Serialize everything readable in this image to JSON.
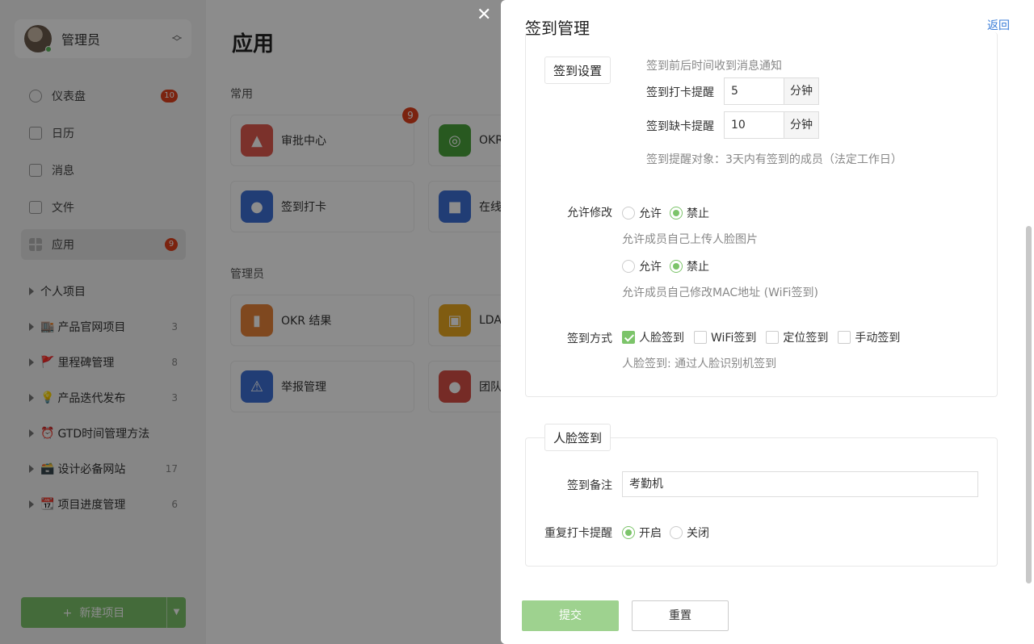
{
  "sidebar": {
    "user": {
      "name": "管理员"
    },
    "nav": [
      {
        "label": "仪表盘",
        "badge": "10"
      },
      {
        "label": "日历",
        "badge": ""
      },
      {
        "label": "消息",
        "badge": ""
      },
      {
        "label": "文件",
        "badge": ""
      },
      {
        "label": "应用",
        "badge": "9"
      }
    ],
    "projects": [
      {
        "emoji": "",
        "label": "个人项目",
        "count": ""
      },
      {
        "emoji": "🏬",
        "label": "产品官网项目",
        "count": "3"
      },
      {
        "emoji": "🚩",
        "label": "里程碑管理",
        "count": "8"
      },
      {
        "emoji": "💡",
        "label": "产品迭代发布",
        "count": "3"
      },
      {
        "emoji": "⏰",
        "label": "GTD时间管理方法",
        "count": ""
      },
      {
        "emoji": "🗃️",
        "label": "设计必备网站",
        "count": "17"
      },
      {
        "emoji": "📆",
        "label": "项目进度管理",
        "count": "6"
      }
    ],
    "new_project": {
      "plus": "+",
      "label": "新建项目"
    }
  },
  "main": {
    "title": "应用",
    "sections": [
      {
        "label": "常用",
        "apps": [
          {
            "name": "审批中心",
            "icon": "stamp-icon",
            "color": "#e05a4f",
            "badge": "9"
          },
          {
            "name": "OKR",
            "icon": "target-icon",
            "color": "#4aa33b",
            "badge": ""
          },
          {
            "name": "签到打卡",
            "icon": "location-pin-icon",
            "color": "#3d6fd6",
            "badge": ""
          },
          {
            "name": "在线",
            "icon": "video-icon",
            "color": "#3d6fd6",
            "badge": ""
          }
        ]
      },
      {
        "label": "管理员",
        "apps": [
          {
            "name": "OKR 结果",
            "icon": "bar-chart-icon",
            "color": "#e8833a",
            "badge": ""
          },
          {
            "name": "LDA",
            "icon": "contact-icon",
            "color": "#e9a820",
            "badge": ""
          },
          {
            "name": "举报管理",
            "icon": "warning-icon",
            "color": "#3d6fd6",
            "badge": ""
          },
          {
            "name": "团队",
            "icon": "team-icon",
            "color": "#d84f45",
            "badge": ""
          }
        ]
      }
    ]
  },
  "drawer": {
    "title": "签到管理",
    "back": "返回",
    "settings": {
      "legend": "签到设置",
      "notify_desc": "签到前后时间收到消息通知",
      "checkin_remind": {
        "label": "签到打卡提醒",
        "value": "5",
        "unit": "分钟"
      },
      "missing_remind": {
        "label": "签到缺卡提醒",
        "value": "10",
        "unit": "分钟"
      },
      "remind_target": "签到提醒对象：3天内有签到的成员（法定工作日）",
      "allow_modify": {
        "label": "允许修改",
        "face_photo": {
          "options": [
            "允许",
            "禁止"
          ],
          "selected": "禁止",
          "desc": "允许成员自己上传人脸图片"
        },
        "mac_address": {
          "options": [
            "允许",
            "禁止"
          ],
          "selected": "禁止",
          "desc": "允许成员自己修改MAC地址 (WiFi签到)"
        }
      },
      "methods": {
        "label": "签到方式",
        "options": [
          {
            "label": "人脸签到",
            "checked": true
          },
          {
            "label": "WiFi签到",
            "checked": false
          },
          {
            "label": "定位签到",
            "checked": false
          },
          {
            "label": "手动签到",
            "checked": false
          }
        ],
        "desc": "人脸签到: 通过人脸识别机签到"
      }
    },
    "face": {
      "legend": "人脸签到",
      "remark": {
        "label": "签到备注",
        "value": "考勤机"
      },
      "repeat_remind": {
        "label": "重复打卡提醒",
        "options": [
          "开启",
          "关闭"
        ],
        "selected": "开启"
      }
    },
    "footer": {
      "submit": "提交",
      "reset": "重置"
    }
  },
  "colors": {
    "accent": "#7cc46a",
    "link": "#3a7dd8",
    "badge": "#e0411c",
    "submit": "#9ed28f"
  }
}
